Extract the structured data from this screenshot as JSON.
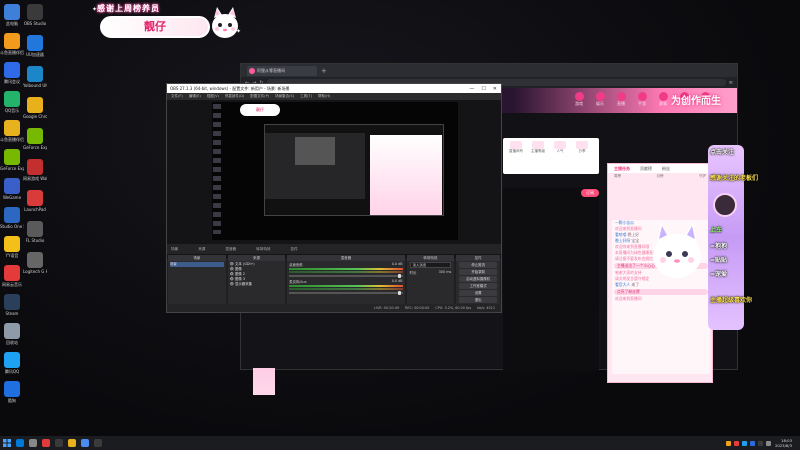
{
  "desktop": {
    "icons_col1": [
      {
        "label": "此电脑",
        "color": "#3d7fd9"
      },
      {
        "label": "斗鱼直播伴侣",
        "color": "#f29a1e"
      },
      {
        "label": "腾讯会议",
        "color": "#2f6be8"
      },
      {
        "label": "QQ音乐",
        "color": "#24b36b"
      },
      {
        "label": "斗鱼直播伴侣",
        "color": "#e8b21e"
      },
      {
        "label": "GeForce Experience",
        "color": "#76b900"
      },
      {
        "label": "WeGame",
        "color": "#3a5fc8"
      },
      {
        "label": "Studio One 5",
        "color": "#2c67c2"
      },
      {
        "label": "YY语音",
        "color": "#f2c018"
      },
      {
        "label": "网易云音乐",
        "color": "#e43a3a"
      },
      {
        "label": "Steam",
        "color": "#2a3f5a"
      },
      {
        "label": "回收站",
        "color": "#8e9aa8"
      },
      {
        "label": "腾讯QQ",
        "color": "#1da1f2"
      },
      {
        "label": "酷狗",
        "color": "#1f6fe0"
      }
    ],
    "icons_col2": [
      {
        "label": "OBS Studio",
        "color": "#3a3a3a"
      },
      {
        "label": "UU加速器",
        "color": "#2277dd"
      },
      {
        "label": "Yolbound Ultimate",
        "color": "#1c86c8"
      },
      {
        "label": "Google Chrome",
        "color": "#e8b11c"
      },
      {
        "label": "GeForce Experience",
        "color": "#76b900"
      },
      {
        "label": "网易游戏 Wallpaper",
        "color": "#c32f2f"
      },
      {
        "label": "LaunchPad",
        "color": "#d93a3a"
      },
      {
        "label": "FL Studio",
        "color": "#5a5a5a"
      },
      {
        "label": "Logitech G HUB",
        "color": "#666666"
      }
    ]
  },
  "overlay_banner": {
    "top_text": "感谢上周榜养员",
    "name": "靓仔"
  },
  "browser": {
    "tab_title": "阿狸从零直播间",
    "nav_items": [
      "游戏",
      "娱乐",
      "直播",
      "手游",
      "赛事",
      "我的",
      "订阅"
    ],
    "logo_text": "为创作而生"
  },
  "room": {
    "info_items": [
      "直播间号",
      "主播等级",
      "人气",
      "分享"
    ],
    "follow_label": "订阅",
    "tags": "可爱声优 热门"
  },
  "chat": {
    "tabs": [
      "主播任务",
      "贡献榜",
      "粉丝"
    ],
    "ranks": [
      "周榜",
      "月榜",
      "守护"
    ],
    "messages": [
      {
        "user": "一颗小苦瓜",
        "text": "",
        "kind": "normal"
      },
      {
        "user": "",
        "text": "欢迎来到直播间",
        "kind": "sys"
      },
      {
        "user": "看哈喽",
        "text": "晚上好",
        "kind": "normal"
      },
      {
        "user": "晚上好呀",
        "text": "宝宝",
        "kind": "normal"
      },
      {
        "user": "",
        "text": "欢迎你来到直播间哦",
        "kind": "sys"
      },
      {
        "user": "",
        "text": "本直播间为绿色健康直播间",
        "kind": "sys"
      },
      {
        "user": "",
        "text": "请注意不要发布违规信息",
        "kind": "sys"
      },
      {
        "user": "",
        "text": "主播送出了一个小心心",
        "kind": "gift"
      },
      {
        "user": "",
        "text": "感谢大家的支持",
        "kind": "sys"
      },
      {
        "user": "",
        "text": "请文明发言遵守规定",
        "kind": "sys"
      },
      {
        "user": "看官大人",
        "text": "来了",
        "kind": "normal"
      },
      {
        "user": "",
        "text": "点亮了粉丝牌",
        "kind": "gift"
      },
      {
        "user": "",
        "text": "欢迎来到直播间",
        "kind": "sys"
      }
    ]
  },
  "obs": {
    "title": "OBS 27.1.3 (64-bit, windows) - 配置文件: 新用户 - 场景: 新场景",
    "window_buttons": [
      "—",
      "☐",
      "✕"
    ],
    "menu": [
      "文件(F)",
      "编辑(E)",
      "视图(V)",
      "停靠部件(D)",
      "配置文件(P)",
      "场景集合(S)",
      "工具(T)",
      "帮助(H)"
    ],
    "preview_banner": "靓仔",
    "dock_titles": [
      "场景",
      "来源",
      "混音器",
      "转场特效",
      "控件"
    ],
    "scenes": [
      "场景"
    ],
    "sources": [
      "文本 (GDI+)",
      "图像",
      "图像 2",
      "图像 3",
      "显示器采集"
    ],
    "mixer": [
      {
        "name": "桌面音频",
        "db": "0.0 dB"
      },
      {
        "name": "麦克风/Aux",
        "db": "0.0 dB"
      }
    ],
    "transition": {
      "type": "淡入淡出",
      "duration_label": "时长",
      "duration": "300 ms"
    },
    "controls": [
      "停止推流",
      "开始录制",
      "启动虚拟摄像机",
      "工作室模式",
      "设置",
      "退出"
    ],
    "status": [
      "LIVE: 00:20:49",
      "REC: 00:00:00",
      "CPU: 3.2%, 60.00 fps",
      "kb/s: 4512"
    ]
  },
  "right_overlay": {
    "lines": [
      {
        "text": "点击关注",
        "color": "#ffffff"
      },
      {
        "text": "感谢关注的老板们",
        "color": "#ffe14d"
      },
      {
        "text": "上车",
        "color": "#8cff66"
      },
      {
        "text": "=抱抱",
        "color": "#ffffff"
      },
      {
        "text": "=贴贴",
        "color": "#ffffff"
      },
      {
        "text": "=宠爱",
        "color": "#ffffff"
      },
      {
        "text": "主播超级喜欢你",
        "color": "#ffe14d"
      }
    ]
  },
  "taskbar": {
    "apps": [
      "#0078d7",
      "#888888",
      "#e33b3b",
      "#3a3a3a",
      "#e8b11c",
      "#4a8cf0",
      "#3b3b3b"
    ],
    "tray": [
      "#f2a01e",
      "#e83b3b",
      "#1da1f2",
      "#2b6be0",
      "#3a3a3a",
      "#888888"
    ],
    "time": "18:03",
    "date": "2023/8/3"
  }
}
